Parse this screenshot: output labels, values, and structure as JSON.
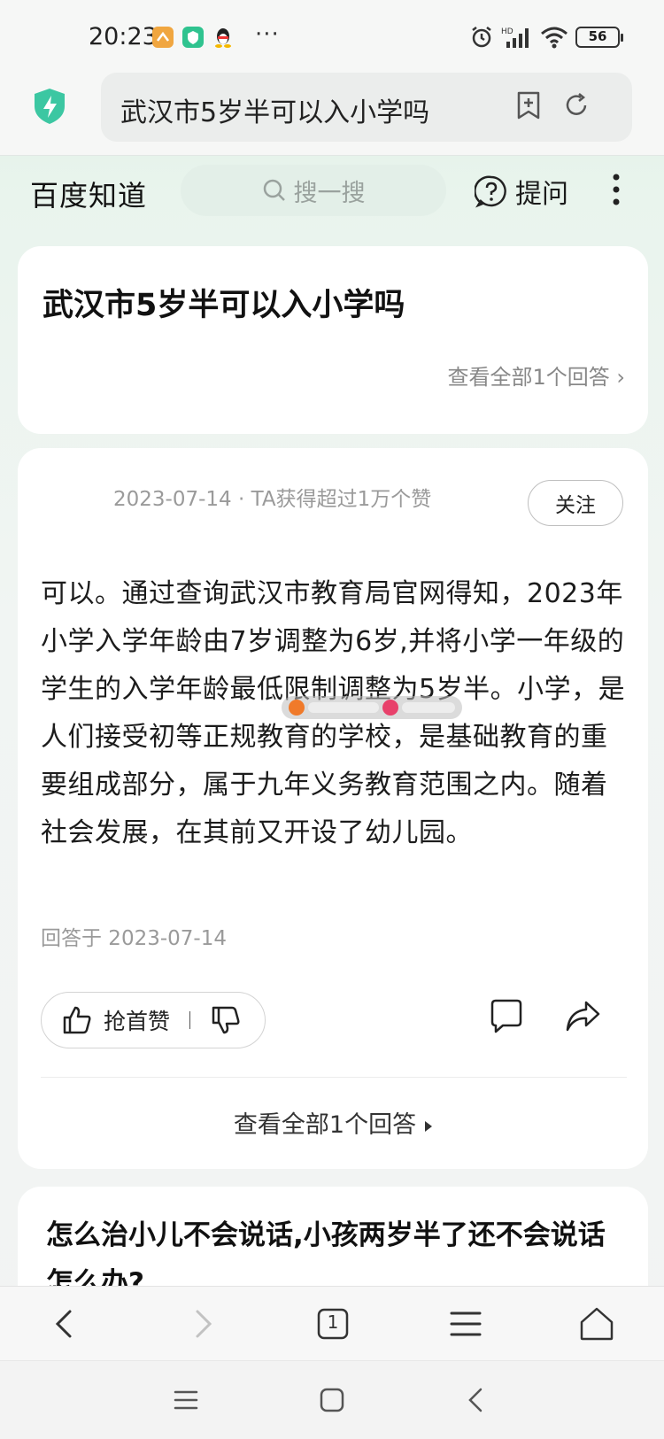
{
  "status_bar": {
    "time": "20:23",
    "battery": "56",
    "icons": [
      "notification-app-icon",
      "shield-app-icon",
      "qq-icon",
      "more-dots-icon",
      "alarm-icon",
      "hd-signal-icon",
      "wifi-icon",
      "battery-icon"
    ],
    "dots": "···"
  },
  "address_bar": {
    "url_text": "武汉市5岁半可以入小学吗",
    "icons": [
      "security-shield-icon",
      "add-bookmark-icon",
      "refresh-icon"
    ]
  },
  "baidu_header": {
    "logo": "百度知道",
    "search_placeholder": "搜一搜",
    "ask_label": "提问",
    "icons": [
      "search-icon",
      "question-icon",
      "more-vertical-icon"
    ]
  },
  "question": {
    "title": "武汉市5岁半可以入小学吗",
    "view_all": "查看全部1个回答"
  },
  "answer": {
    "meta": "2023-07-14 · TA获得超过1万个赞",
    "follow_label": "关注",
    "body": "可以。通过查询武汉市教育局官网得知，2023年小学入学年龄由7岁调整为6岁,并将小学一年级的学生的入学年龄最低限制调整为5岁半。小学，是人们接受初等正规教育的学校，是基础教育的重要组成部分，属于九年义务教育范围之内。随着社会发展，在其前又开设了幼儿园。",
    "date": "回答于 2023-07-14",
    "like_label": "抢首赞",
    "view_all": "查看全部1个回答"
  },
  "related": {
    "title": "怎么治小儿不会说话,小孩两岁半了还不会说话怎么办?"
  },
  "browser_bar": {
    "tab_count": "1",
    "icons": [
      "back-icon",
      "forward-icon",
      "tabs-icon",
      "menu-icon",
      "home-icon"
    ]
  },
  "system_nav": {
    "icons": [
      "recent-apps-icon",
      "home-nav-icon",
      "back-nav-icon"
    ]
  },
  "colors": {
    "accent_green": "#2fc38f",
    "header_gradient_top": "#dcefe3",
    "card_bg": "#ffffff",
    "muted_text": "#9a9a9a"
  }
}
